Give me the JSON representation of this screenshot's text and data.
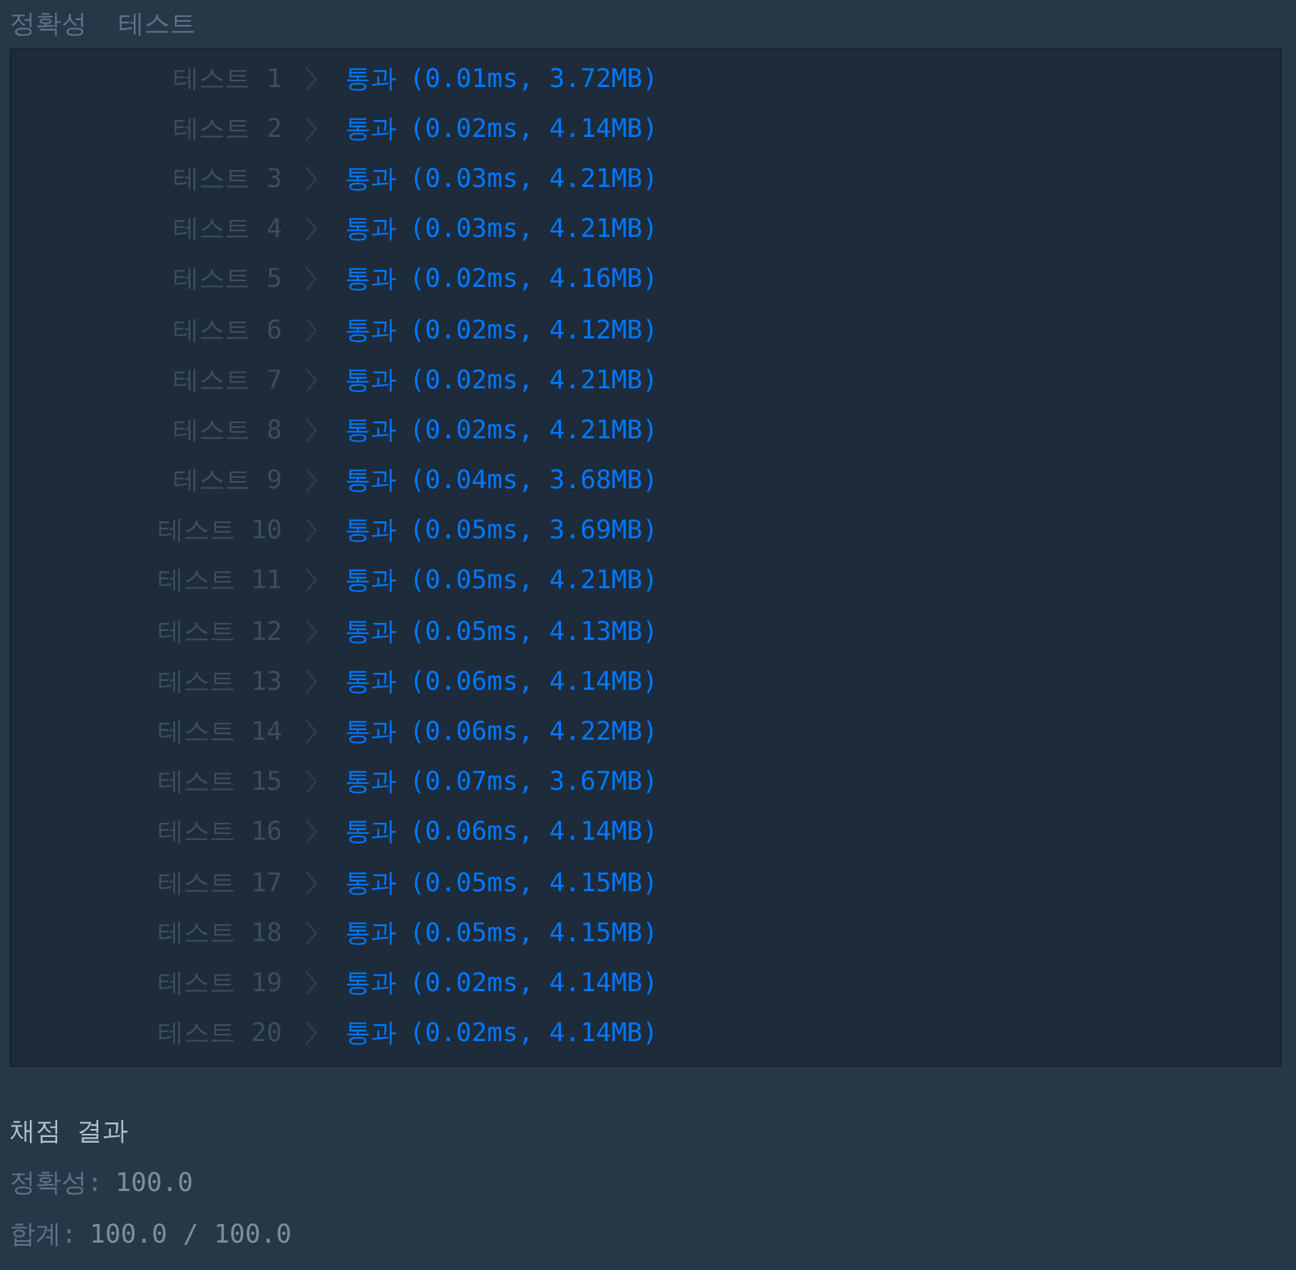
{
  "section_title": "정확성  테스트",
  "tests": [
    {
      "label": "테스트 1",
      "result": "통과",
      "detail": "(0.01ms, 3.72MB)"
    },
    {
      "label": "테스트 2",
      "result": "통과",
      "detail": "(0.02ms, 4.14MB)"
    },
    {
      "label": "테스트 3",
      "result": "통과",
      "detail": "(0.03ms, 4.21MB)"
    },
    {
      "label": "테스트 4",
      "result": "통과",
      "detail": "(0.03ms, 4.21MB)"
    },
    {
      "label": "테스트 5",
      "result": "통과",
      "detail": "(0.02ms, 4.16MB)"
    },
    {
      "label": "테스트 6",
      "result": "통과",
      "detail": "(0.02ms, 4.12MB)"
    },
    {
      "label": "테스트 7",
      "result": "통과",
      "detail": "(0.02ms, 4.21MB)"
    },
    {
      "label": "테스트 8",
      "result": "통과",
      "detail": "(0.02ms, 4.21MB)"
    },
    {
      "label": "테스트 9",
      "result": "통과",
      "detail": "(0.04ms, 3.68MB)"
    },
    {
      "label": "테스트 10",
      "result": "통과",
      "detail": "(0.05ms, 3.69MB)"
    },
    {
      "label": "테스트 11",
      "result": "통과",
      "detail": "(0.05ms, 4.21MB)"
    },
    {
      "label": "테스트 12",
      "result": "통과",
      "detail": "(0.05ms, 4.13MB)"
    },
    {
      "label": "테스트 13",
      "result": "통과",
      "detail": "(0.06ms, 4.14MB)"
    },
    {
      "label": "테스트 14",
      "result": "통과",
      "detail": "(0.06ms, 4.22MB)"
    },
    {
      "label": "테스트 15",
      "result": "통과",
      "detail": "(0.07ms, 3.67MB)"
    },
    {
      "label": "테스트 16",
      "result": "통과",
      "detail": "(0.06ms, 4.14MB)"
    },
    {
      "label": "테스트 17",
      "result": "통과",
      "detail": "(0.05ms, 4.15MB)"
    },
    {
      "label": "테스트 18",
      "result": "통과",
      "detail": "(0.05ms, 4.15MB)"
    },
    {
      "label": "테스트 19",
      "result": "통과",
      "detail": "(0.02ms, 4.14MB)"
    },
    {
      "label": "테스트 20",
      "result": "통과",
      "detail": "(0.02ms, 4.14MB)"
    }
  ],
  "summary": {
    "title": "채점 결과",
    "lines": [
      {
        "label": "정확성:",
        "value": "100.0"
      },
      {
        "label": "합계:",
        "value": "100.0 / 100.0"
      }
    ]
  }
}
